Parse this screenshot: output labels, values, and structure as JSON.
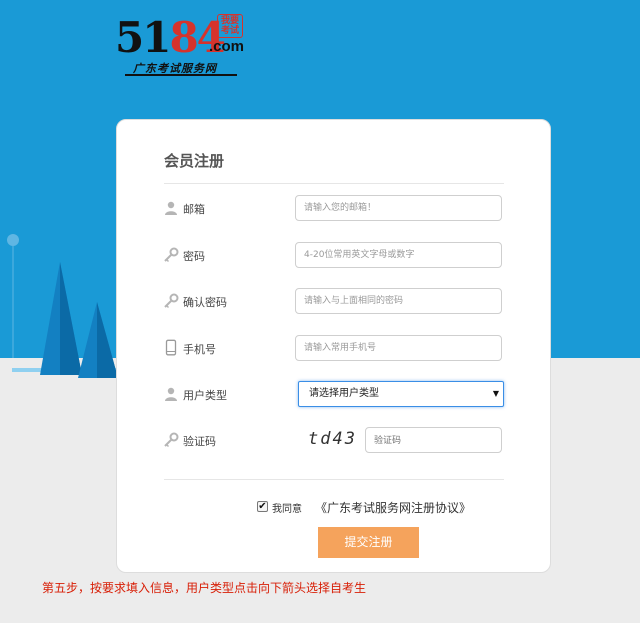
{
  "logo": {
    "numeral_a": "51",
    "numeral_b": "84",
    "domain": ".com",
    "seal_text": "我要考试",
    "subtitle": "广东考试服务网"
  },
  "form": {
    "title": "会员注册",
    "fields": [
      {
        "label": "邮箱",
        "placeholder": "请输入您的邮箱！",
        "icon": "user-icon"
      },
      {
        "label": "密码",
        "placeholder": "4-20位常用英文字母或数字",
        "icon": "key-icon"
      },
      {
        "label": "确认密码",
        "placeholder": "请输入与上面相同的密码",
        "icon": "key-icon"
      },
      {
        "label": "手机号",
        "placeholder": "请输入常用手机号",
        "icon": "phone-icon"
      },
      {
        "label": "用户类型",
        "selected": "请选择用户类型",
        "icon": "user-icon"
      },
      {
        "label": "验证码",
        "placeholder": "验证码",
        "captcha": "td43",
        "icon": "key-icon"
      }
    ],
    "agree_label": "我同意",
    "agreement_link": "《广东考试服务网注册协议》",
    "agree_checked": true,
    "submit_label": "提交注册"
  },
  "caption": "第五步，按要求填入信息，用户类型点击向下箭头选择自考生",
  "colors": {
    "header_bg": "#1a9ad6",
    "submit_bg": "#f5a35c",
    "caption": "#d81e06"
  }
}
